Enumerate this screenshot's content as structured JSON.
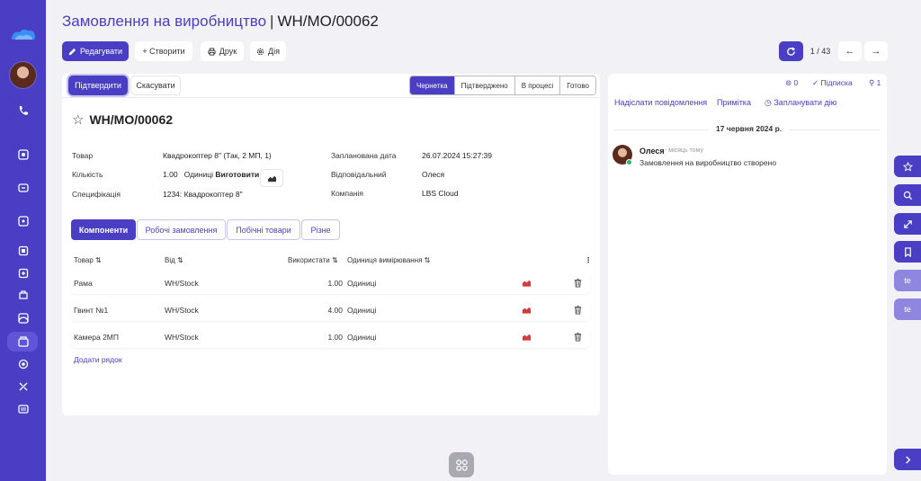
{
  "header": {
    "title": "Замовлення на виробництво",
    "separator": "|",
    "record_ref": "WH/MO/00062"
  },
  "toolbar": {
    "edit_label": "Редагувати",
    "create_label": "+ Створити",
    "print_label": "Друк",
    "action_label": "Дія"
  },
  "pager": {
    "count": "1 / 43",
    "prev": "←",
    "next": "→"
  },
  "statusbar": {
    "confirm_label": "Підтвердити",
    "cancel_label": "Скасувати",
    "stages": [
      "Чернетка",
      "Підтверджено",
      "В процесі",
      "Готово"
    ],
    "active_stage": "Чернетка"
  },
  "record": {
    "star": "☆",
    "name": "WH/MO/00062",
    "product_label": "Товар",
    "product_value": "Квадрокоптер 8\" (Так, 2 МП, 1)",
    "quantity_label": "Кількість",
    "quantity_value": "1.00",
    "quantity_uom": "Одиниці",
    "quantity_produce": "Виготовити",
    "bom_label": "Специфікація",
    "bom_value": "1234: Квадрокоптер 8\"",
    "date_label": "Запланована дата",
    "date_value": "26.07.2024 15:27:39",
    "responsible_label": "Відповідальний",
    "responsible_value": "Олеся",
    "company_label": "Компанія",
    "company_value": "LBS Cloud"
  },
  "tabs": [
    "Компоненти",
    "Робочі замовлення",
    "Побічні товари",
    "Різне"
  ],
  "table": {
    "headers": {
      "product": "Товар ⇅",
      "from": "Від ⇅",
      "used": "Використати ⇅",
      "uom": "Одиниця вимірювання ⇅"
    },
    "rows": [
      {
        "product": "Рама",
        "from": "WH/Stock",
        "qty": "1.00",
        "uom": "Одиниці"
      },
      {
        "product": "Гвинт №1",
        "from": "WH/Stock",
        "qty": "4.00",
        "uom": "Одиниці"
      },
      {
        "product": "Камера 2МП",
        "from": "WH/Stock",
        "qty": "1.00",
        "uom": "Одиниці"
      }
    ],
    "add_row": "Додати рядок"
  },
  "chatter": {
    "attachments_count": "0",
    "follow_label": "Підписка",
    "followers_count": "1",
    "send_message": "Надіслати повідомлення",
    "log_note": "Примітка",
    "schedule_activity": "Запланувати дію",
    "date_separator": "17 червня 2024 р.",
    "message": {
      "author": "Олеся",
      "time": "- місяць тому",
      "body": "Замовлення на виробництво створено"
    }
  },
  "dock": {
    "te1": "te",
    "te2": "te"
  },
  "colors": {
    "accent": "#4a3fc4",
    "sidebar": "#4a3fc4",
    "background": "#f2f2f6",
    "online": "#2bb673",
    "chart_red": "#d63b3b"
  }
}
